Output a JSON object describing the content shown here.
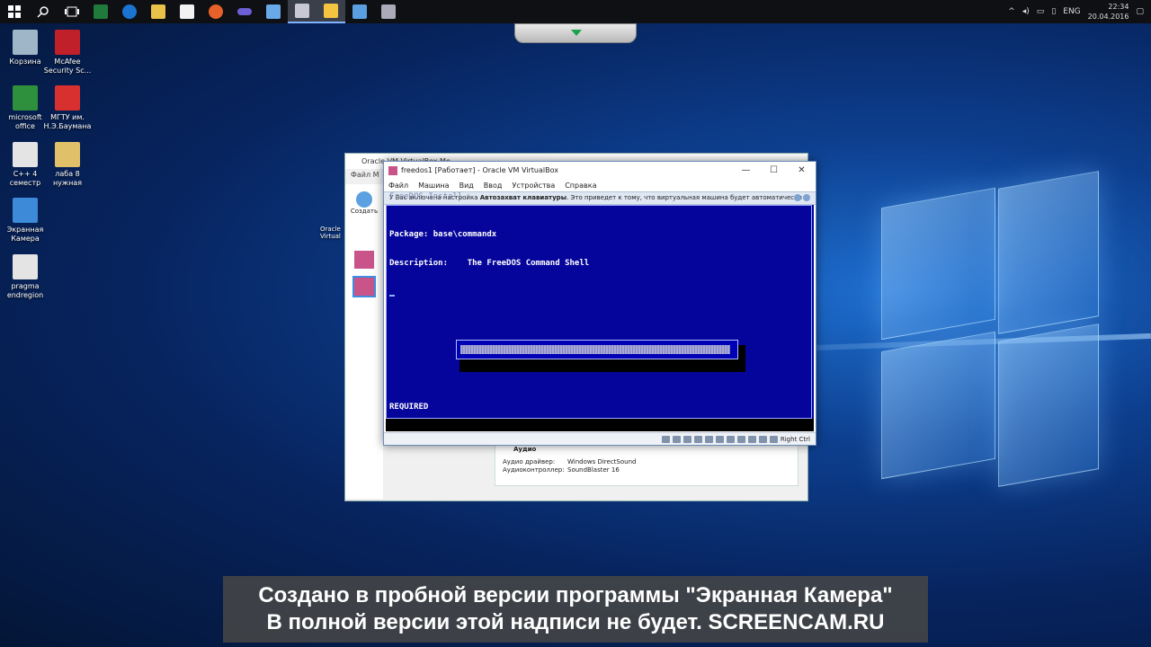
{
  "taskbar": {
    "buttons": [
      "start",
      "search",
      "task-view",
      "excel",
      "edge",
      "explorer",
      "store",
      "firefox",
      "app-infinity",
      "app-manager",
      "virtualbox",
      "virtualbox-vm",
      "remote-desktop",
      "network-tool"
    ],
    "tray": {
      "lang": "ENG",
      "time": "22:34",
      "date": "20.04.2016"
    }
  },
  "desktop_icons": [
    {
      "label": "Корзина",
      "color": "#9fb6c8"
    },
    {
      "label": "McAfee Security Sc...",
      "color": "#c0202a"
    },
    {
      "label": "microsoft office",
      "color": "#2e8f3d"
    },
    {
      "label": "МГТУ им. Н.Э.Баумана",
      "color": "#d8302f"
    },
    {
      "label": "C++ 4 семестр",
      "color": "#e4e4e4"
    },
    {
      "label": "лаба 8 нужная",
      "color": "#e0c16a"
    },
    {
      "label": "Экранная Камера",
      "color": "#3c8ad8"
    },
    {
      "label": "pragma endregion",
      "color": "#e4e4e4"
    }
  ],
  "manager": {
    "title": "Oracle VM VirtualBox Ме...",
    "menu": "Файл  М",
    "create_label": "Создать",
    "side_label": "Oracle Virtual",
    "audio": {
      "header": "Аудио",
      "rows": [
        [
          "Аудио драйвер:",
          "Windows DirectSound"
        ],
        [
          "Аудиоконтроллер:",
          "SoundBlaster 16"
        ]
      ]
    }
  },
  "vm": {
    "title": "freedos1 [Работает] - Oracle VM VirtualBox",
    "menu": [
      "Файл",
      "Машина",
      "Вид",
      "Ввод",
      "Устройства",
      "Справка"
    ],
    "notice_prefix": "У Вас включена настройка ",
    "notice_bold": "Автозахват клавиатуры",
    "notice_suffix": ". Это приведет к тому, что виртуальная машина будет автоматически",
    "faded": "FreeDOS Install",
    "screen": {
      "package": "Package: base\\commandx",
      "description": "Description:    The FreeDOS Command Shell",
      "footer": "REQUIRED",
      "progress": 1.0
    },
    "host_key": "Right Ctrl"
  },
  "watermark": {
    "line1": "Создано в пробной версии программы \"Экранная Камера\"",
    "line2": "В полной версии этой надписи не будет. SCREENCAM.RU"
  }
}
